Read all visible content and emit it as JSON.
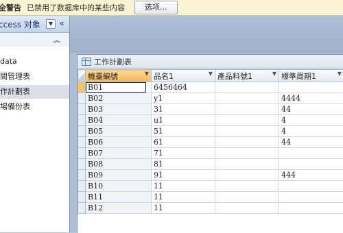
{
  "message_bar": {
    "warning_label": "全警告",
    "text": "已禁用了数据库中的某些内容",
    "options_button": "选项..."
  },
  "nav": {
    "title": "ccess 对象",
    "items": [
      {
        "label": "data",
        "selected": false
      },
      {
        "label": "間管理表",
        "selected": false
      },
      {
        "label": "作計劃表",
        "selected": true
      },
      {
        "label": "場備份表",
        "selected": false
      }
    ]
  },
  "document": {
    "tab_label": "工作計劃表",
    "columns": [
      "機臺編號",
      "品名1",
      "產品料號1",
      "標準周期1"
    ],
    "rows": [
      [
        "B01",
        "6456464",
        "",
        ""
      ],
      [
        "B02",
        "y1",
        "",
        "4444"
      ],
      [
        "B03",
        "31",
        "",
        "44"
      ],
      [
        "B04",
        "u1",
        "",
        "4"
      ],
      [
        "B05",
        "51",
        "",
        "4"
      ],
      [
        "B06",
        "61",
        "",
        "44"
      ],
      [
        "B07",
        "71",
        "",
        ""
      ],
      [
        "B08",
        "81",
        "",
        ""
      ],
      [
        "B09",
        "91",
        "",
        "444"
      ],
      [
        "B10",
        "11",
        "",
        ""
      ],
      [
        "B11",
        "11",
        "",
        ""
      ],
      [
        "B12",
        "11",
        "",
        ""
      ]
    ]
  }
}
